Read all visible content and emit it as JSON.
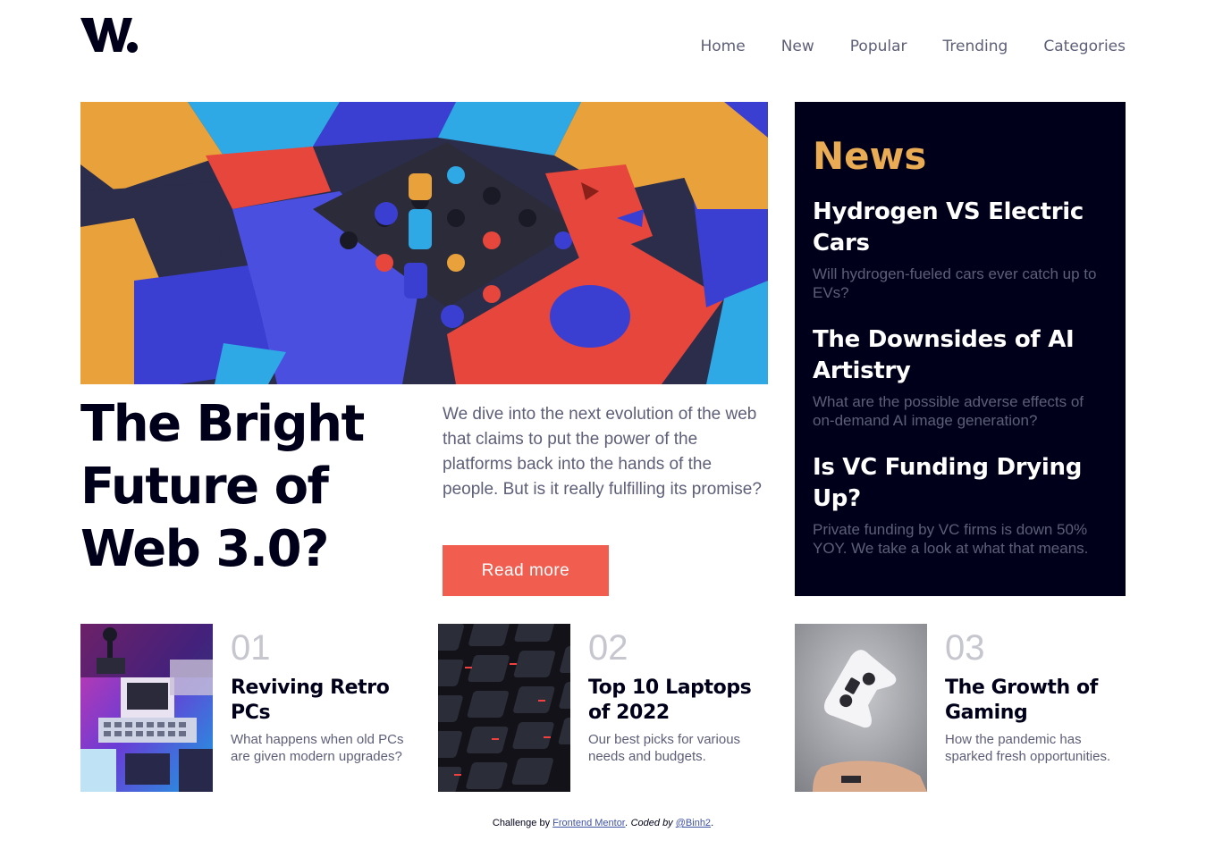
{
  "header": {
    "logo_text": "W.",
    "nav": [
      {
        "label": "Home"
      },
      {
        "label": "New"
      },
      {
        "label": "Popular"
      },
      {
        "label": "Trending"
      },
      {
        "label": "Categories"
      }
    ]
  },
  "hero": {
    "image_icon": "abstract-3d-blocks-image",
    "title": "The Bright Future of Web 3.0?",
    "description": "We dive into the next evolution of the web that claims to put the power of the platforms back into the hands of the people. But is it really fulfilling its promise?",
    "button_label": "Read more"
  },
  "news": {
    "heading": "News",
    "items": [
      {
        "title": "Hydrogen VS Electric Cars",
        "description": "Will hydrogen-fueled cars ever catch up to EVs?"
      },
      {
        "title": "The Downsides of AI Artistry",
        "description": "What are the possible adverse effects of on-demand AI image generation?"
      },
      {
        "title": "Is VC Funding Drying Up?",
        "description": "Private funding by VC firms is down 50% YOY. We take a look at what that means."
      }
    ]
  },
  "cards": [
    {
      "number": "01",
      "title": "Reviving Retro PCs",
      "description": "What happens when old PCs are given modern upgrades?",
      "image_icon": "retro-pc-image"
    },
    {
      "number": "02",
      "title": "Top 10 Laptops of 2022",
      "description": "Our best picks for various needs and budgets.",
      "image_icon": "laptop-keyboard-image"
    },
    {
      "number": "03",
      "title": "The Growth of Gaming",
      "description": "How the pandemic has sparked fresh opportunities.",
      "image_icon": "gamepad-image"
    }
  ],
  "footer": {
    "prefix": "Challenge by ",
    "link1": "Frontend Mentor",
    "middle": ". Coded by ",
    "link2": "@Binh2",
    "suffix": "."
  },
  "colors": {
    "accent_orange": "#e9ab53",
    "button_red": "#f15e50",
    "dark_navy": "#00001a",
    "grey_text": "#5d5f79",
    "muted_number": "#c5c6ce"
  }
}
